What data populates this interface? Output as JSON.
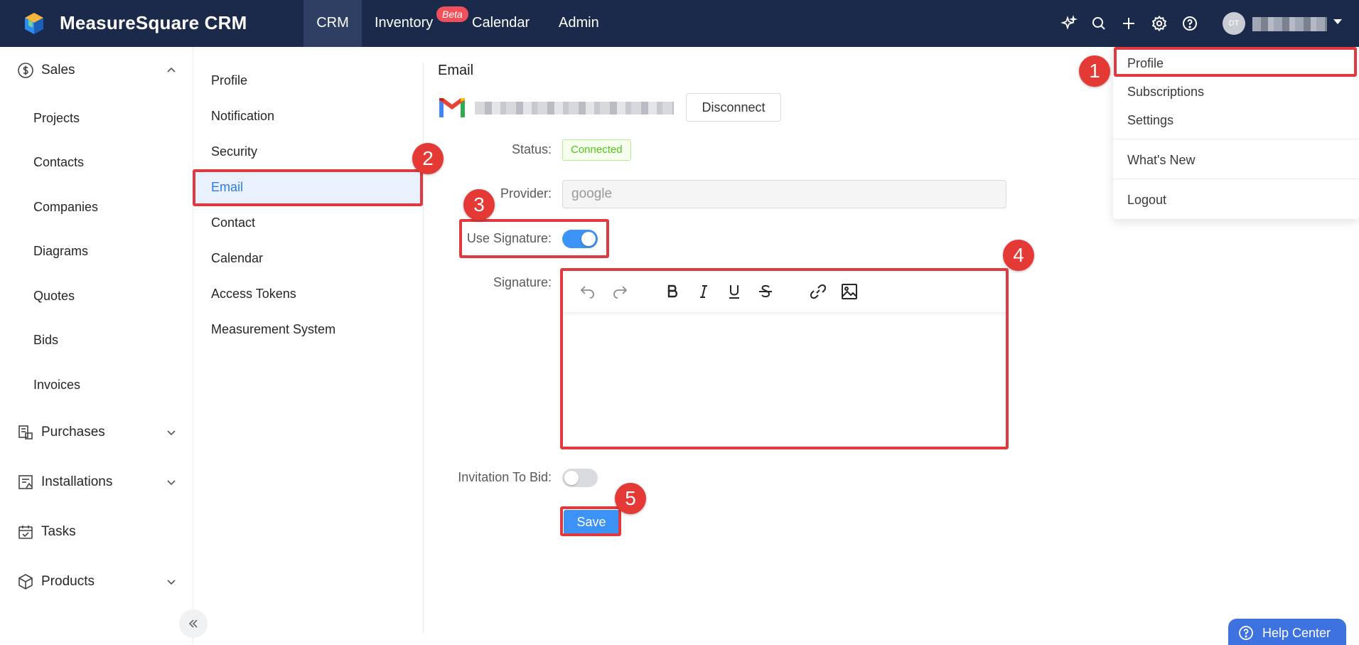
{
  "app": {
    "title": "MeasureSquare CRM"
  },
  "topnav": {
    "items": [
      "CRM",
      "Inventory",
      "Calendar",
      "Admin"
    ],
    "active": "CRM",
    "beta_badge": "Beta"
  },
  "user": {
    "initials": "DT"
  },
  "sidebar": {
    "sales_label": "Sales",
    "sales_items": [
      "Projects",
      "Contacts",
      "Companies",
      "Diagrams",
      "Quotes",
      "Bids",
      "Invoices"
    ],
    "purchases_label": "Purchases",
    "installations_label": "Installations",
    "tasks_label": "Tasks",
    "products_label": "Products"
  },
  "settings_menu": {
    "items": [
      "Profile",
      "Notification",
      "Security",
      "Email",
      "Contact",
      "Calendar",
      "Access Tokens",
      "Measurement System"
    ],
    "active": "Email"
  },
  "email": {
    "section_title": "Email",
    "disconnect_label": "Disconnect",
    "status_label": "Status:",
    "status_value": "Connected",
    "provider_label": "Provider:",
    "provider_value": "google",
    "use_signature_label": "Use Signature:",
    "use_signature_on": true,
    "signature_label": "Signature:",
    "invitation_label": "Invitation To Bid:",
    "invitation_on": false,
    "save_label": "Save"
  },
  "user_menu": {
    "items": [
      "Profile",
      "Subscriptions",
      "Settings",
      "What's New",
      "Logout"
    ]
  },
  "annotations": [
    "1",
    "2",
    "3",
    "4",
    "5"
  ],
  "help": {
    "label": "Help Center"
  },
  "colors": {
    "topbar": "#1b2a4a",
    "accent": "#3d92f5",
    "annotation": "#e03a3e",
    "connected": "#52c41a"
  }
}
